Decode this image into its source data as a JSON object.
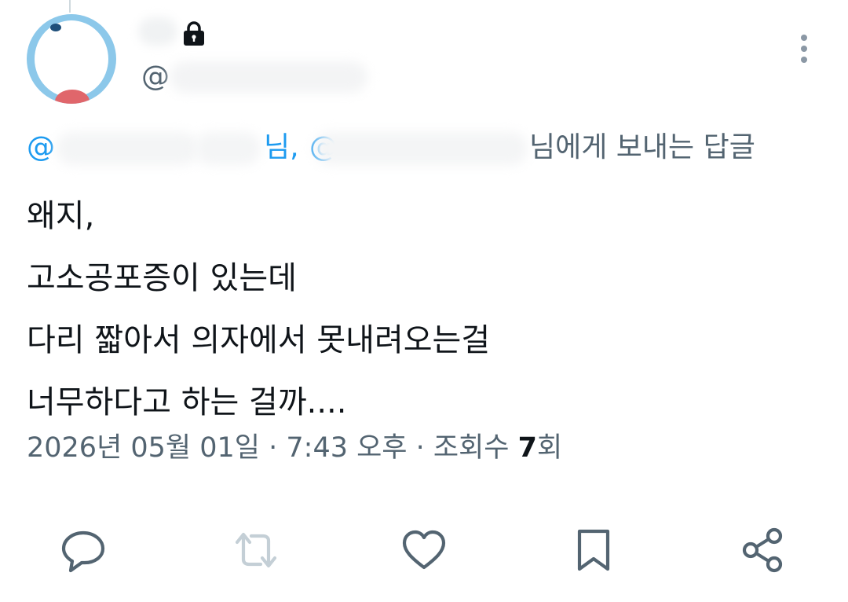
{
  "author": {
    "handle_prefix": "@",
    "protected_icon": "lock-icon"
  },
  "reply": {
    "mention_prefix_1": "@",
    "suffix_1": "님, ",
    "mention_prefix_2": "@",
    "suffix_2": "님에게 보내는 답글"
  },
  "tweet": {
    "lines": [
      "왜지,",
      "고소공포증이 있는데",
      "다리 짧아서 의자에서 못내려오는걸",
      "너무하다고 하는 걸까...."
    ]
  },
  "meta": {
    "date": "2026년 05월 01일",
    "separator": " · ",
    "time": "7:43 오후",
    "views_label": "조회수 ",
    "views_count": "7",
    "views_unit": "회"
  },
  "actions": [
    "reply-icon",
    "retweet-icon",
    "like-icon",
    "bookmark-icon",
    "share-icon"
  ],
  "colors": {
    "mention": "#1d9bf0",
    "muted": "#536471",
    "text": "#0f1419",
    "retweet_disabled": "#c4cfd6"
  }
}
